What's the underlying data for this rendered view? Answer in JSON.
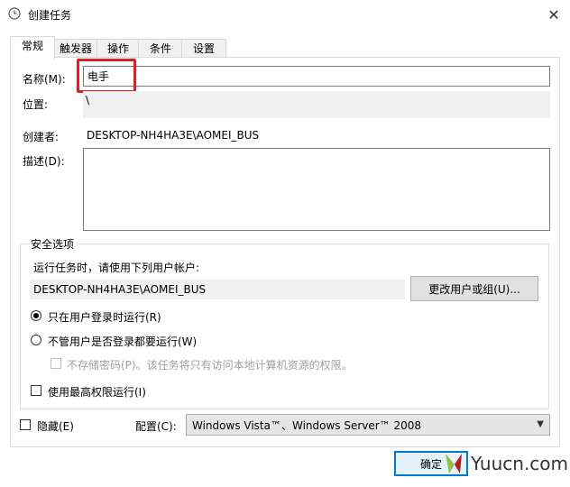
{
  "window": {
    "title": "创建任务",
    "close_glyph": "✕"
  },
  "tabs": [
    {
      "label": "常规"
    },
    {
      "label": "触发器"
    },
    {
      "label": "操作"
    },
    {
      "label": "条件"
    },
    {
      "label": "设置"
    }
  ],
  "general": {
    "name_label": "名称(M):",
    "name_value": "电手",
    "location_label": "位置:",
    "location_value": "\\",
    "author_label": "创建者:",
    "author_value": "DESKTOP-NH4HA3E\\AOMEI_BUS",
    "description_label": "描述(D):",
    "description_value": ""
  },
  "security": {
    "legend": "安全选项",
    "run_as_label": "运行任务时，请使用下列用户帐户:",
    "run_as_value": "DESKTOP-NH4HA3E\\AOMEI_BUS",
    "change_user_button": "更改用户或组(U)...",
    "radio_logged_on": "只在用户登录时运行(R)",
    "radio_logged_on_selected": true,
    "radio_any": "不管用户是否登录都要运行(W)",
    "no_store_password": "不存储密码(P)。该任务将只有访问本地计算机资源的权限。",
    "highest_privileges": "使用最高权限运行(I)"
  },
  "footer": {
    "hidden_label": "隐藏(E)",
    "configure_label": "配置(C):",
    "configure_value": "Windows Vista™、Windows Server™ 2008",
    "ok_button": "确定"
  },
  "watermark": {
    "text": "Yuucn.com"
  },
  "colors": {
    "highlight": "#e02020",
    "primary_border": "#0078d7"
  }
}
